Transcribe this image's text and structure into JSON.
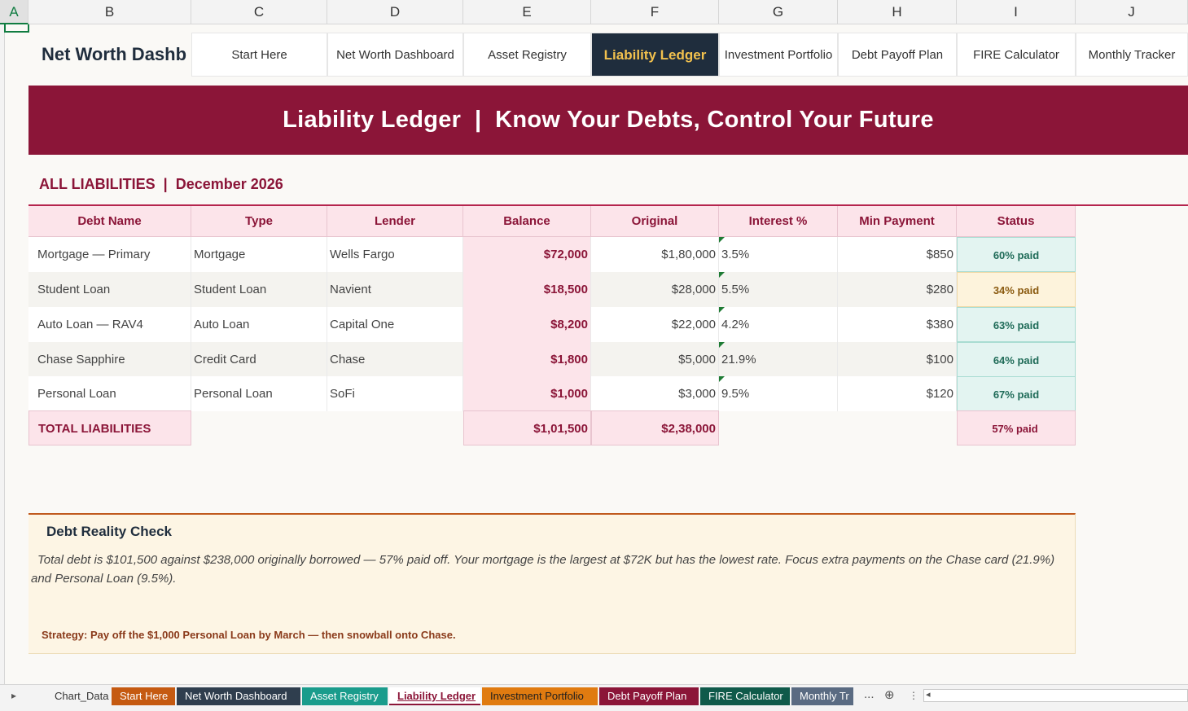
{
  "columns": [
    "A",
    "B",
    "C",
    "D",
    "E",
    "F",
    "G",
    "H",
    "I",
    "J"
  ],
  "nav": {
    "brand": "Net Worth Dashb",
    "items": [
      "Start Here",
      "Net Worth Dashboard",
      "Asset Registry",
      "Liability Ledger",
      "Investment Portfolio",
      "Debt Payoff Plan",
      "FIRE Calculator",
      "Monthly Tracker"
    ],
    "active": "Liability Ledger"
  },
  "banner": "Liability Ledger  |  Know Your Debts, Control Your Future",
  "section_title": "ALL LIABILITIES  |  December 2026",
  "table": {
    "headers": [
      "Debt Name",
      "Type",
      "Lender",
      "Balance",
      "Original",
      "Interest %",
      "Min Payment",
      "Status"
    ],
    "rows": [
      {
        "name": "Mortgage — Primary",
        "type": "Mortgage",
        "lender": "Wells Fargo",
        "balance": "$72,000",
        "original": "$1,80,000",
        "interest": "3.5%",
        "min": "$850",
        "status": "60% paid",
        "status_tone": "green"
      },
      {
        "name": "Student Loan",
        "type": "Student Loan",
        "lender": "Navient",
        "balance": "$18,500",
        "original": "$28,000",
        "interest": "5.5%",
        "min": "$280",
        "status": "34% paid",
        "status_tone": "amber"
      },
      {
        "name": "Auto Loan — RAV4",
        "type": "Auto Loan",
        "lender": "Capital One",
        "balance": "$8,200",
        "original": "$22,000",
        "interest": "4.2%",
        "min": "$380",
        "status": "63% paid",
        "status_tone": "green"
      },
      {
        "name": "Chase Sapphire",
        "type": "Credit Card",
        "lender": "Chase",
        "balance": "$1,800",
        "original": "$5,000",
        "interest": "21.9%",
        "min": "$100",
        "status": "64% paid",
        "status_tone": "green"
      },
      {
        "name": "Personal Loan",
        "type": "Personal Loan",
        "lender": "SoFi",
        "balance": "$1,000",
        "original": "$3,000",
        "interest": "9.5%",
        "min": "$120",
        "status": "67% paid",
        "status_tone": "green"
      }
    ],
    "total": {
      "label": "TOTAL LIABILITIES",
      "balance": "$1,01,500",
      "original": "$2,38,000",
      "status": "57% paid"
    }
  },
  "reality_check": {
    "title": "Debt Reality Check",
    "body": "Total debt is $101,500 against $238,000 originally borrowed — 57% paid off. Your mortgage is the largest at $72K but has the lowest rate. Focus extra payments on the Chase card (21.9%) and Personal Loan (9.5%).",
    "strategy": "Strategy: Pay off the $1,000 Personal Loan by March — then snowball onto Chase."
  },
  "sheet_tabs": [
    {
      "label": "Chart_Data",
      "bg": "#f3f3f3",
      "fg": "#333333"
    },
    {
      "label": "Start Here",
      "bg": "#c55a11",
      "fg": "#ffffff"
    },
    {
      "label": "Net Worth Dashboard",
      "bg": "#2f3e4e",
      "fg": "#ffffff"
    },
    {
      "label": "Asset Registry",
      "bg": "#1a9c8c",
      "fg": "#ffffff"
    },
    {
      "label": "Liability Ledger",
      "bg": "#ffffff",
      "fg": "#8b1538"
    },
    {
      "label": "Investment Portfolio",
      "bg": "#e07b10",
      "fg": "#1f1f1f"
    },
    {
      "label": "Debt Payoff Plan",
      "bg": "#8b1538",
      "fg": "#ffffff"
    },
    {
      "label": "FIRE Calculator",
      "bg": "#0f5a4a",
      "fg": "#ffffff"
    },
    {
      "label": "Monthly Tr",
      "bg": "#5a6b82",
      "fg": "#ffffff"
    }
  ],
  "tab_overflow": "...",
  "colors": {
    "accent": "#8b1538",
    "navy": "#1f2d3d",
    "gold": "#f2c14e"
  }
}
